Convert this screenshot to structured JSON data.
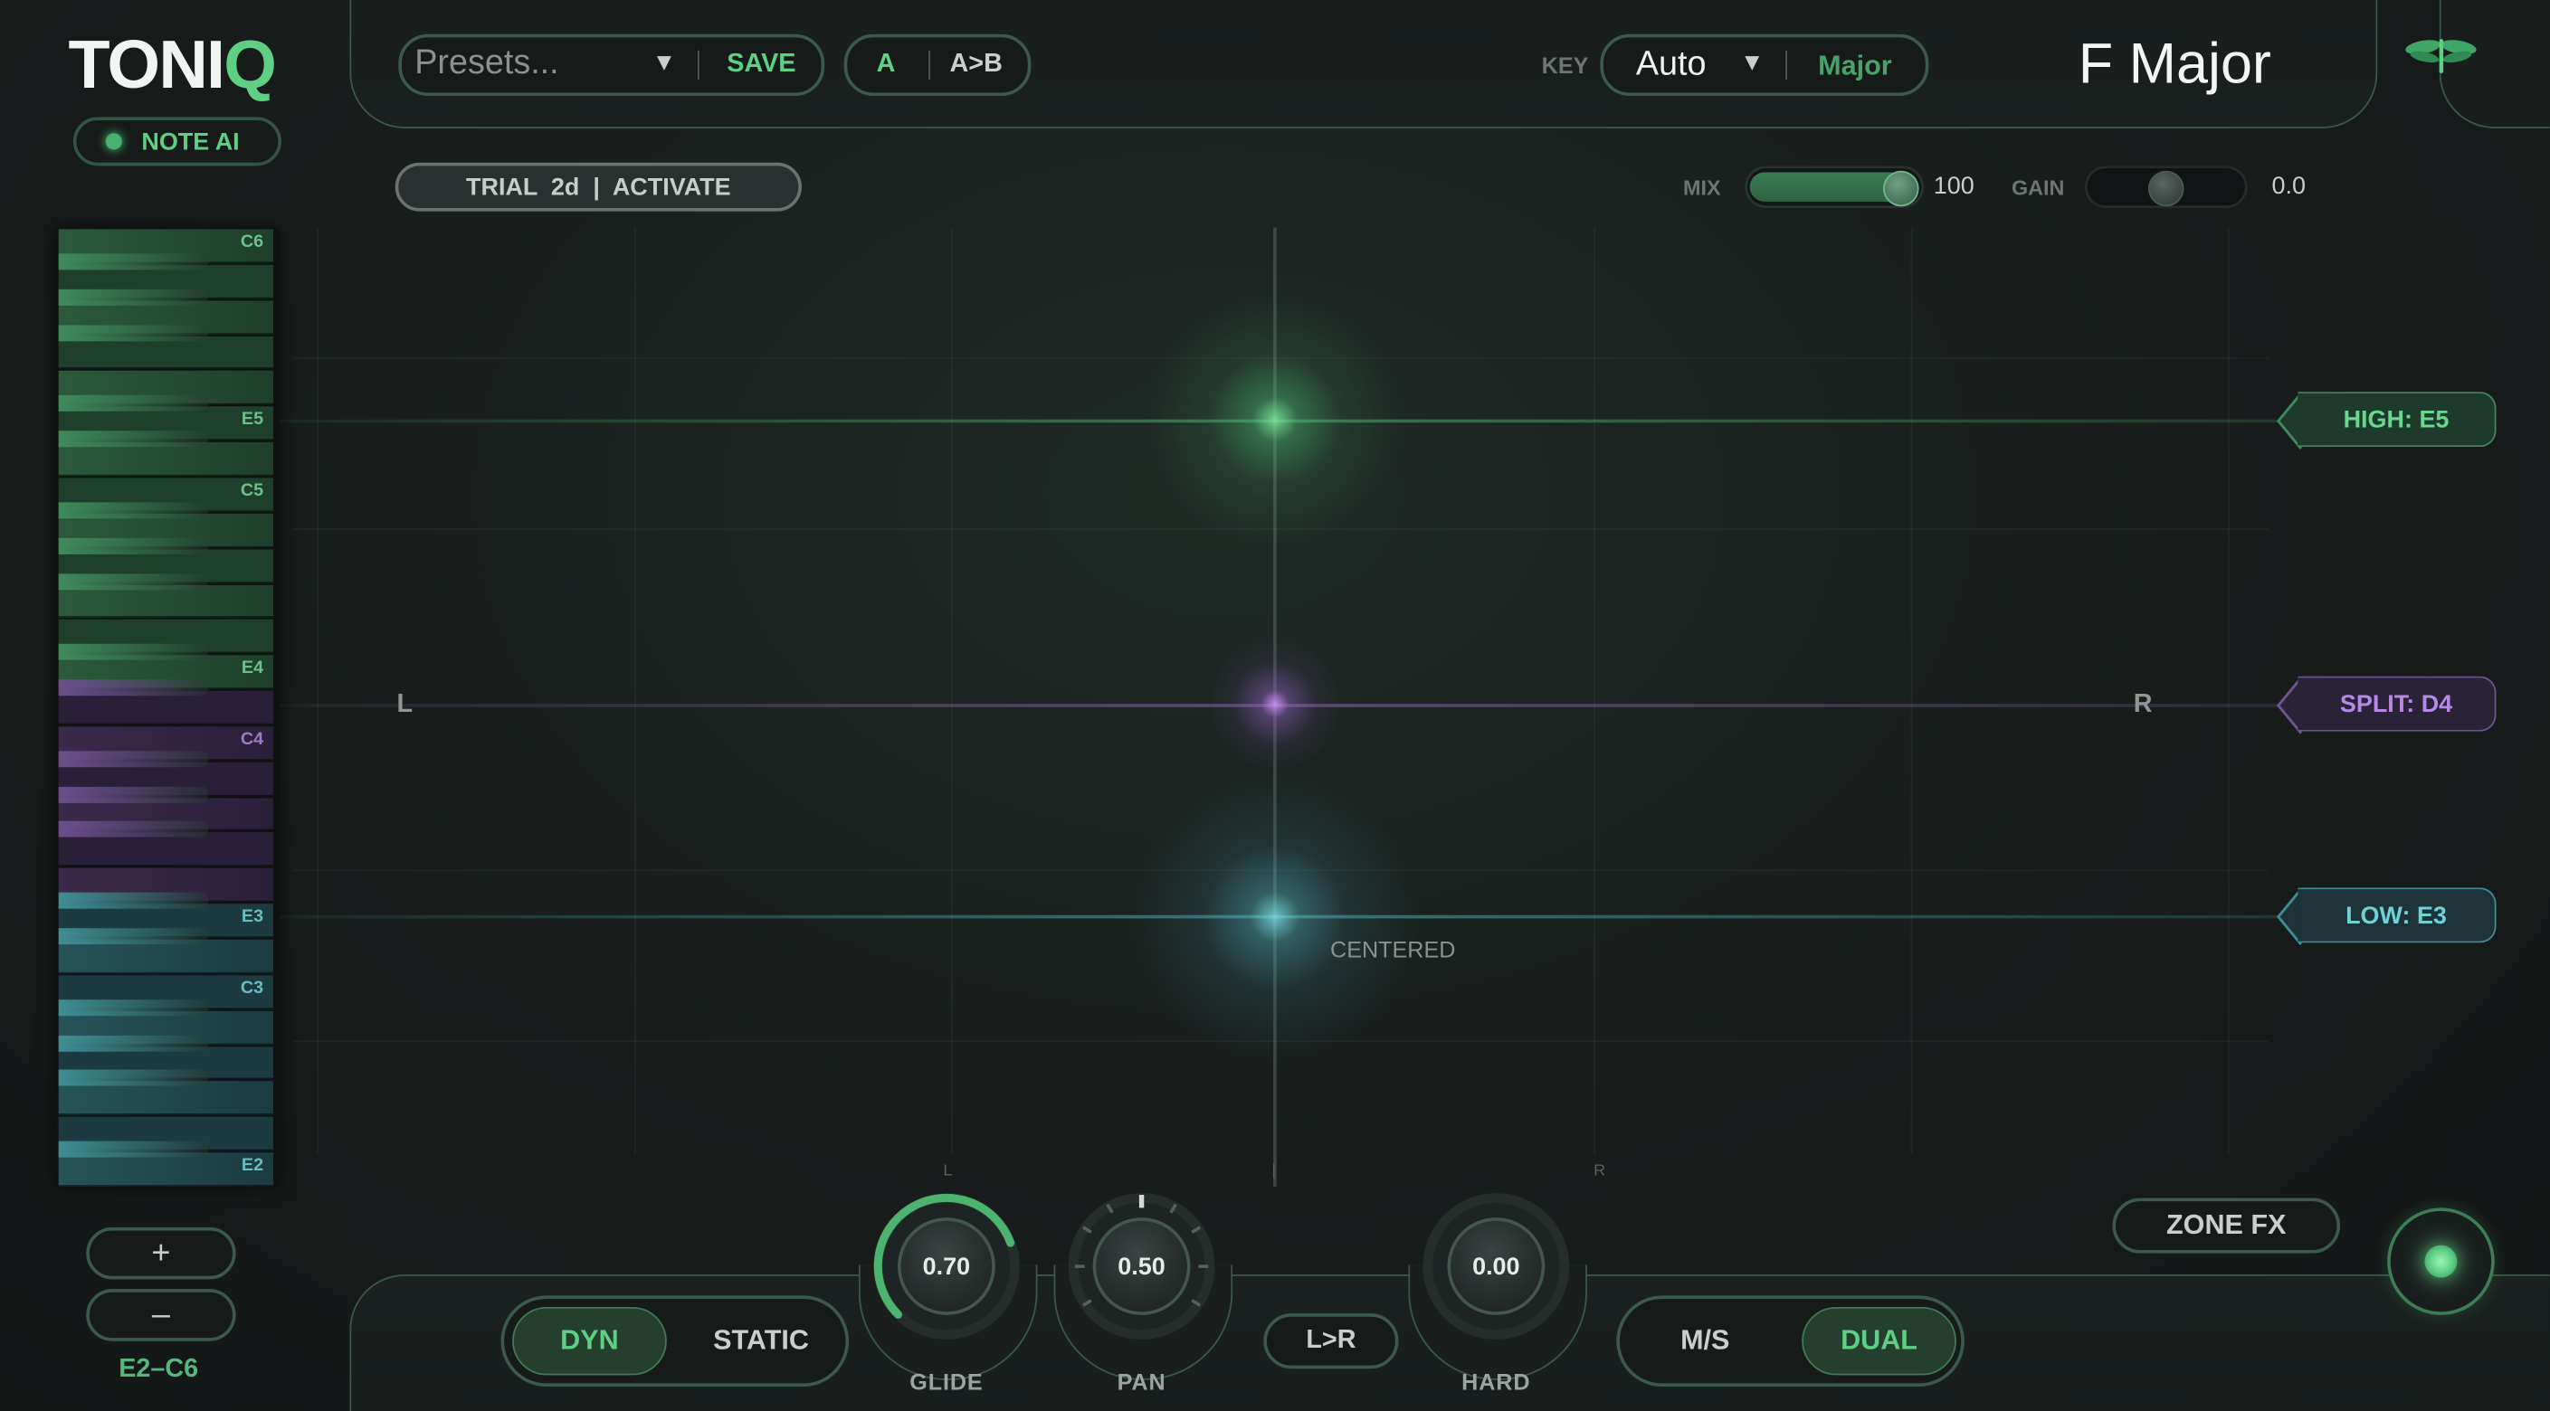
{
  "brand": {
    "logo_main": "TONI",
    "logo_accent": "Q"
  },
  "note_ai": {
    "label": "NOTE AI"
  },
  "presets": {
    "placeholder": "Presets...",
    "arrow": "▼",
    "save_label": "SAVE"
  },
  "ab": {
    "a_label": "A",
    "ab_label": "A>B"
  },
  "key": {
    "label": "KEY",
    "value": "Auto",
    "arrow": "▼",
    "scale": "Major",
    "detected": "F Major"
  },
  "trial": {
    "text": "TRIAL  2d  |  ACTIVATE"
  },
  "mix": {
    "label": "MIX",
    "value": "100",
    "fill_fraction": 0.95
  },
  "gain": {
    "label": "GAIN",
    "value": "0.0",
    "position_fraction": 0.5
  },
  "keyboard": {
    "labels": [
      "C6",
      "E5",
      "C5",
      "E4",
      "C4",
      "E3",
      "C3",
      "E2"
    ],
    "range_label": "E2–C6",
    "plus_label": "+",
    "minus_label": "–"
  },
  "field": {
    "left_label": "L",
    "right_label": "R",
    "centered_label": "CENTERED",
    "axis_ticks": [
      "L",
      "|",
      "R"
    ]
  },
  "zones": {
    "high": "HIGH: E5",
    "split": "SPLIT: D4",
    "low": "LOW: E3"
  },
  "modes": {
    "dyn": "DYN",
    "static": "STATIC",
    "lr": "L>R",
    "ms": "M/S",
    "dual": "DUAL"
  },
  "knobs": {
    "glide": {
      "label": "GLIDE",
      "value": "0.70"
    },
    "pan": {
      "label": "PAN",
      "value": "0.50"
    },
    "hard": {
      "label": "HARD",
      "value": "0.00"
    }
  },
  "zone_fx": {
    "label": "ZONE FX"
  },
  "colors": {
    "accent_green": "#5fcf84",
    "accent_purple": "#a77ad6",
    "accent_teal": "#5cc2c9"
  },
  "icons": {
    "brand_icon": "dragonfly-icon",
    "power_icon": "power-icon"
  }
}
